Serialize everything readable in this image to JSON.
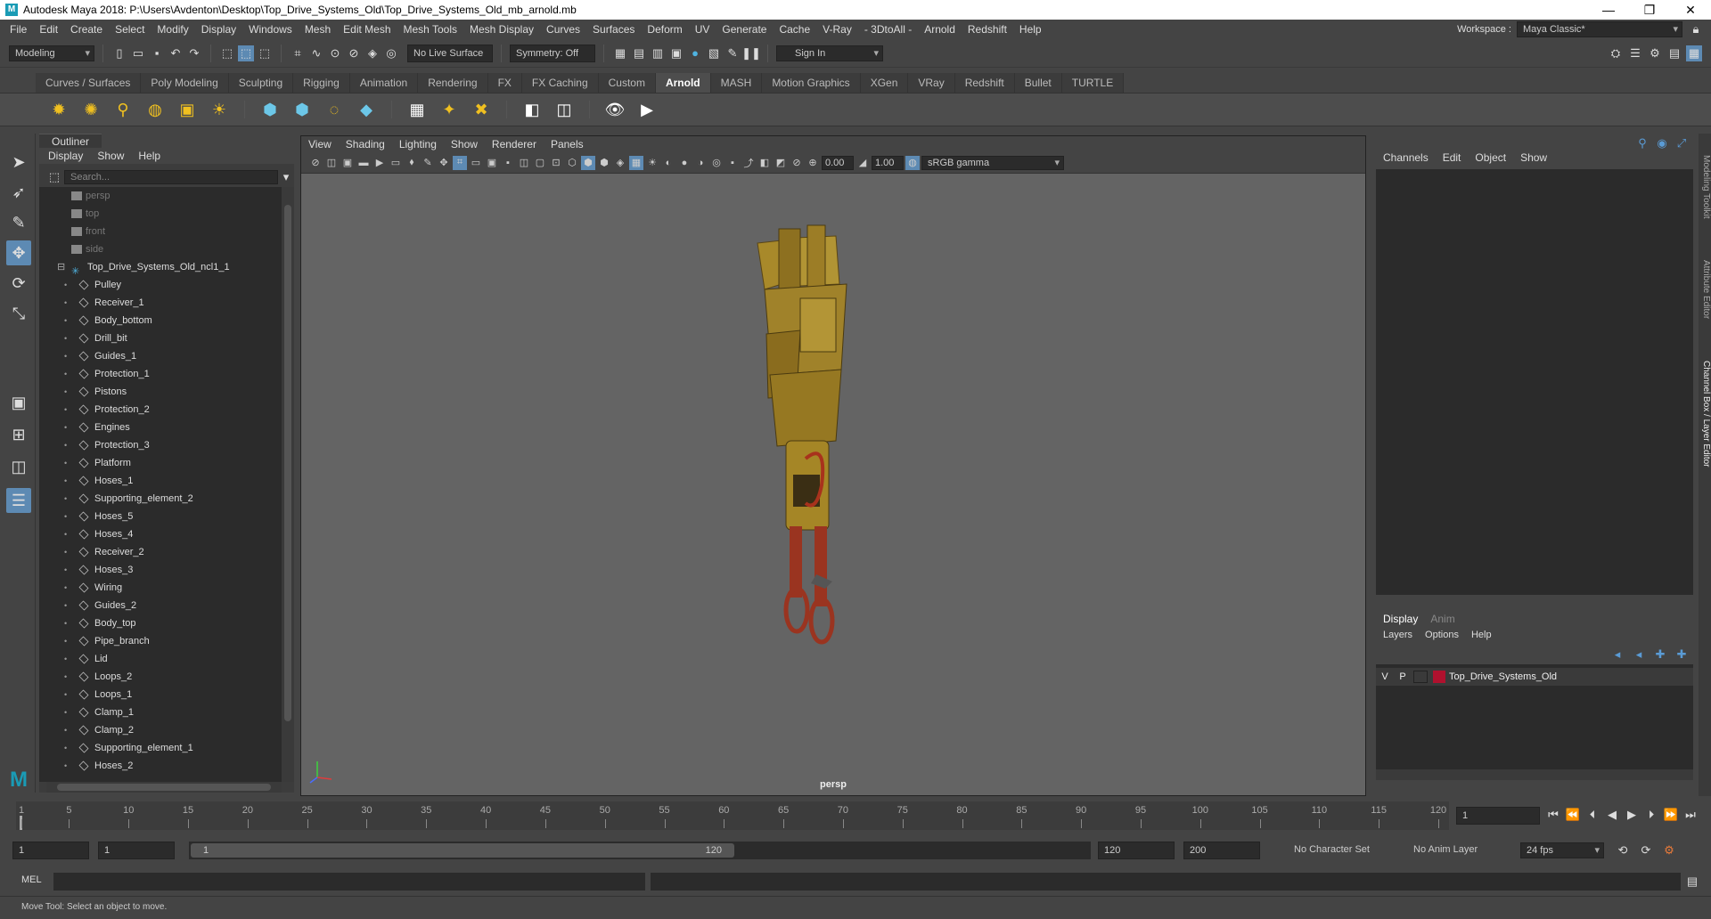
{
  "title": "Autodesk Maya 2018: P:\\Users\\Avdenton\\Desktop\\Top_Drive_Systems_Old\\Top_Drive_Systems_Old_mb_arnold.mb",
  "window_buttons": [
    "—",
    "❐",
    "✕"
  ],
  "menus": [
    "File",
    "Edit",
    "Create",
    "Select",
    "Modify",
    "Display",
    "Windows",
    "Mesh",
    "Edit Mesh",
    "Mesh Tools",
    "Mesh Display",
    "Curves",
    "Surfaces",
    "Deform",
    "UV",
    "Generate",
    "Cache",
    "V-Ray",
    "- 3DtoAll -",
    "Arnold",
    "Redshift",
    "Help"
  ],
  "workspace": {
    "label": "Workspace :",
    "value": "Maya Classic*"
  },
  "status": {
    "mode": "Modeling",
    "live_surface": "No Live Surface",
    "symmetry": "Symmetry: Off",
    "sign_in": "Sign In"
  },
  "shelf_tabs": [
    "Curves / Surfaces",
    "Poly Modeling",
    "Sculpting",
    "Rigging",
    "Animation",
    "Rendering",
    "FX",
    "FX Caching",
    "Custom",
    "Arnold",
    "MASH",
    "Motion Graphics",
    "XGen",
    "VRay",
    "Redshift",
    "Bullet",
    "TURTLE"
  ],
  "shelf_active": "Arnold",
  "outliner": {
    "tab": "Outliner",
    "menu": [
      "Display",
      "Show",
      "Help"
    ],
    "search_placeholder": "Search...",
    "cameras": [
      "persp",
      "top",
      "front",
      "side"
    ],
    "group": "Top_Drive_Systems_Old_ncl1_1",
    "items": [
      "Pulley",
      "Receiver_1",
      "Body_bottom",
      "Drill_bit",
      "Guides_1",
      "Protection_1",
      "Pistons",
      "Protection_2",
      "Engines",
      "Protection_3",
      "Platform",
      "Hoses_1",
      "Supporting_element_2",
      "Hoses_5",
      "Hoses_4",
      "Receiver_2",
      "Hoses_3",
      "Wiring",
      "Guides_2",
      "Body_top",
      "Pipe_branch",
      "Lid",
      "Loops_2",
      "Loops_1",
      "Clamp_1",
      "Clamp_2",
      "Supporting_element_1",
      "Hoses_2"
    ]
  },
  "viewport": {
    "menu": [
      "View",
      "Shading",
      "Lighting",
      "Show",
      "Renderer",
      "Panels"
    ],
    "exposure": "0.00",
    "gamma": "1.00",
    "color_space": "sRGB gamma",
    "camera_label": "persp"
  },
  "channel_box": {
    "menu": [
      "Channels",
      "Edit",
      "Object",
      "Show"
    ]
  },
  "layer_editor": {
    "tabs": [
      "Display",
      "Anim"
    ],
    "menu": [
      "Layers",
      "Options",
      "Help"
    ],
    "layer": {
      "v": "V",
      "p": "P",
      "name": "Top_Drive_Systems_Old",
      "color": "#b0112e"
    }
  },
  "side_tabs": [
    "Modeling Toolkit",
    "Attribute Editor",
    "Channel Box / Layer Editor"
  ],
  "timeline": {
    "ticks": [
      "1",
      "5",
      "10",
      "15",
      "20",
      "25",
      "30",
      "35",
      "40",
      "45",
      "50",
      "55",
      "60",
      "65",
      "70",
      "75",
      "80",
      "85",
      "90",
      "95",
      "100",
      "105",
      "110",
      "115",
      "120"
    ],
    "current_frame": "1"
  },
  "range": {
    "start": "1",
    "anim_start": "1",
    "slider_start": "1",
    "slider_end": "120",
    "end": "120",
    "anim_end": "200",
    "character_set": "No Character Set",
    "anim_layer": "No Anim Layer",
    "fps": "24 fps"
  },
  "command": {
    "label": "MEL"
  },
  "help_line": "Move Tool: Select an object to move."
}
